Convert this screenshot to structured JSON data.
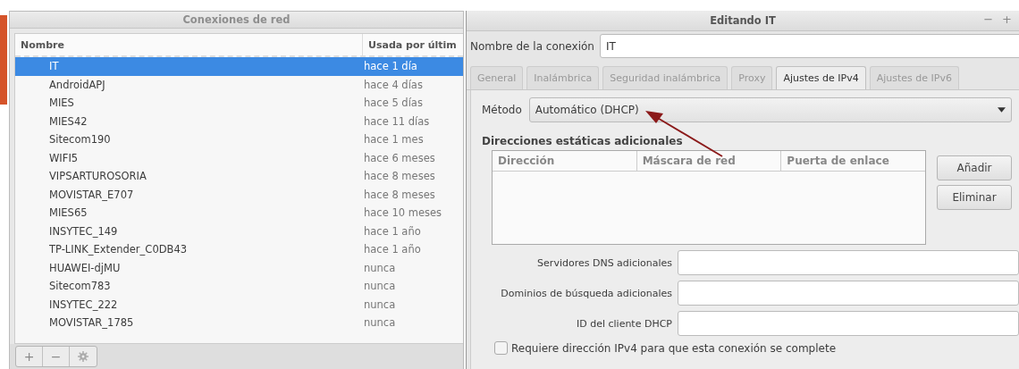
{
  "connections_window": {
    "title": "Conexiones de red",
    "columns": [
      "Nombre",
      "Usada por últim"
    ],
    "rows": [
      {
        "name": "IT",
        "last_used": "hace 1 día",
        "selected": true
      },
      {
        "name": "AndroidAPJ",
        "last_used": "hace 4 días",
        "selected": false
      },
      {
        "name": "MIES",
        "last_used": "hace 5 días",
        "selected": false
      },
      {
        "name": "MIES42",
        "last_used": "hace 11 días",
        "selected": false
      },
      {
        "name": "Sitecom190",
        "last_used": "hace 1 mes",
        "selected": false
      },
      {
        "name": "WIFI5",
        "last_used": "hace 6 meses",
        "selected": false
      },
      {
        "name": "VIPSARTUROSORIA",
        "last_used": "hace 8 meses",
        "selected": false
      },
      {
        "name": "MOVISTAR_E707",
        "last_used": "hace 8 meses",
        "selected": false
      },
      {
        "name": "MIES65",
        "last_used": "hace 10 meses",
        "selected": false
      },
      {
        "name": "INSYTEC_149",
        "last_used": "hace 1 año",
        "selected": false
      },
      {
        "name": "TP-LINK_Extender_C0DB43",
        "last_used": "hace 1 año",
        "selected": false
      },
      {
        "name": "HUAWEI-djMU",
        "last_used": "nunca",
        "selected": false
      },
      {
        "name": "Sitecom783",
        "last_used": "nunca",
        "selected": false
      },
      {
        "name": "INSYTEC_222",
        "last_used": "nunca",
        "selected": false
      },
      {
        "name": "MOVISTAR_1785",
        "last_used": "nunca",
        "selected": false
      }
    ],
    "toolbar": [
      "+",
      "−"
    ]
  },
  "edit_window": {
    "title": "Editando IT",
    "window_buttons": [
      "−",
      "+"
    ],
    "connection_name": {
      "label": "Nombre de la conexión",
      "value": "IT"
    },
    "tabs": [
      {
        "label": "General",
        "selected": false
      },
      {
        "label": "Inalámbrica",
        "selected": false
      },
      {
        "label": "Seguridad inalámbrica",
        "selected": false
      },
      {
        "label": "Proxy",
        "selected": false
      },
      {
        "label": "Ajustes de IPv4",
        "selected": true
      },
      {
        "label": "Ajustes de IPv6",
        "selected": false
      }
    ],
    "method": {
      "label": "Método",
      "value": "Automático (DHCP)"
    },
    "static_addresses": {
      "title": "Direcciones estáticas adicionales",
      "columns": [
        "Dirección",
        "Máscara de red",
        "Puerta de enlace"
      ],
      "buttons": [
        "Añadir",
        "Eliminar"
      ]
    },
    "fields": [
      {
        "label": "Servidores DNS adicionales"
      },
      {
        "label": "Dominios de búsqueda adicionales"
      },
      {
        "label": "ID del cliente DHCP"
      }
    ],
    "require_ipv4": {
      "label": "Requiere dirección IPv4 para que esta conexión se complete",
      "checked": false
    }
  }
}
